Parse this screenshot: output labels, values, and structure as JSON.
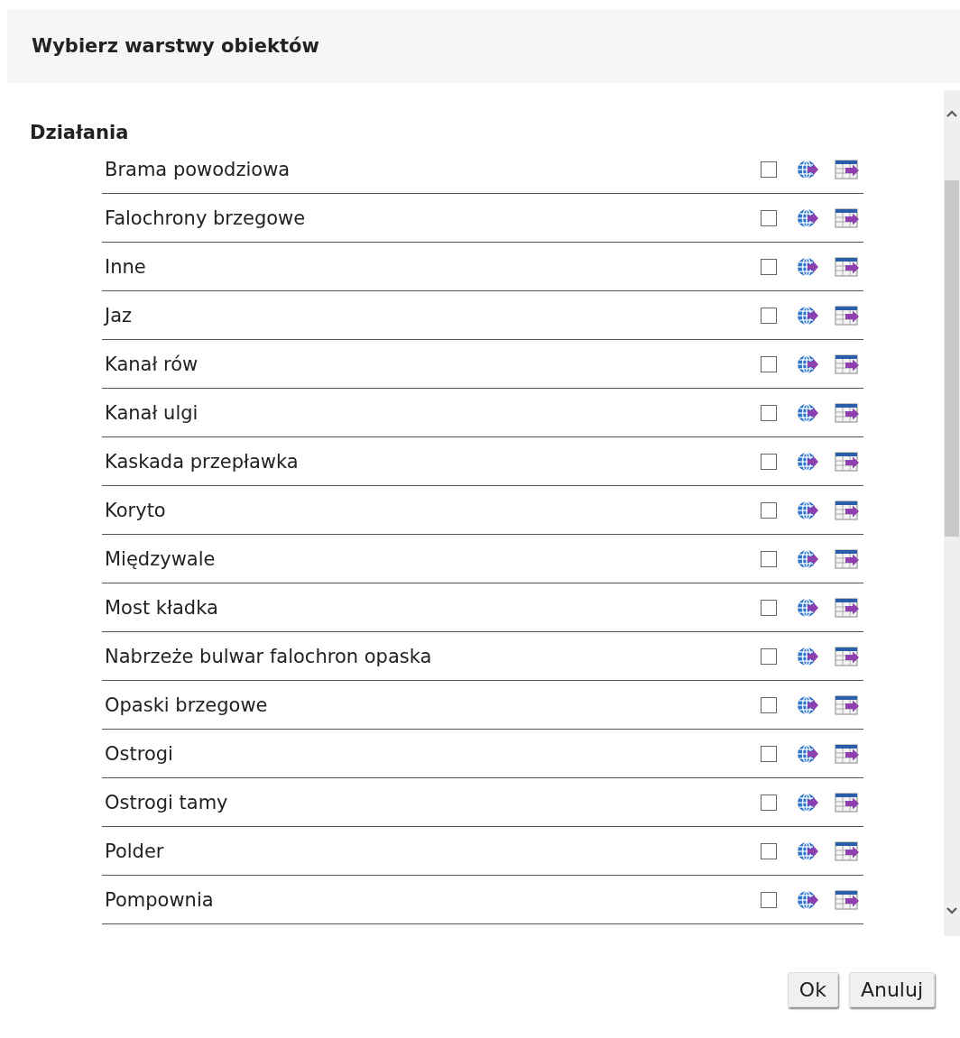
{
  "dialog": {
    "title": "Wybierz warstwy obiektów"
  },
  "section": {
    "title": "Działania"
  },
  "layers": [
    {
      "name": "Brama powodziowa",
      "checked": false
    },
    {
      "name": "Falochrony brzegowe",
      "checked": false
    },
    {
      "name": "Inne",
      "checked": false
    },
    {
      "name": "Jaz",
      "checked": false
    },
    {
      "name": "Kanał rów",
      "checked": false
    },
    {
      "name": "Kanał ulgi",
      "checked": false
    },
    {
      "name": "Kaskada przepławka",
      "checked": false
    },
    {
      "name": "Koryto",
      "checked": false
    },
    {
      "name": "Międzywale",
      "checked": false
    },
    {
      "name": "Most kładka",
      "checked": false
    },
    {
      "name": "Nabrzeże bulwar falochron opaska",
      "checked": false
    },
    {
      "name": "Opaski brzegowe",
      "checked": false
    },
    {
      "name": "Ostrogi",
      "checked": false
    },
    {
      "name": "Ostrogi tamy",
      "checked": false
    },
    {
      "name": "Polder",
      "checked": false
    },
    {
      "name": "Pompownia",
      "checked": false
    }
  ],
  "buttons": [
    "Ok",
    "Anuluj"
  ]
}
